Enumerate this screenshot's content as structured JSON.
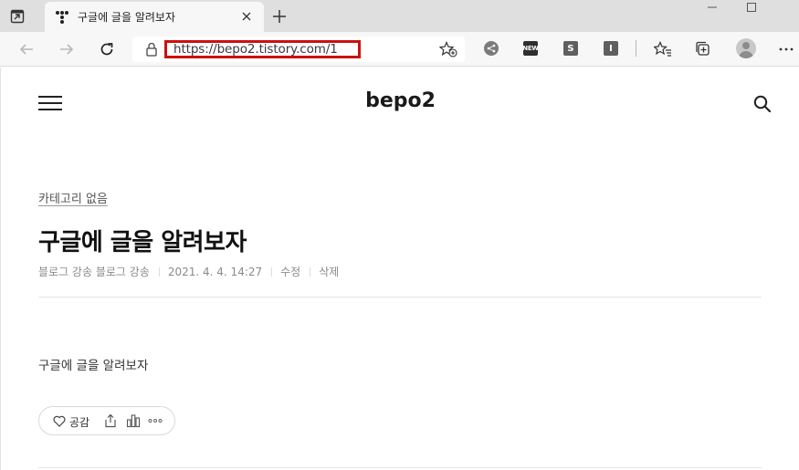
{
  "browser": {
    "tab": {
      "title": "구글에 글을 알려보자"
    },
    "address_bar": {
      "url": "https://bepo2.tistory.com/1"
    },
    "extensions": [
      {
        "icon": "share-extension-icon",
        "label": ""
      },
      {
        "icon": "new-badge-extension-icon",
        "label": "NEW"
      },
      {
        "icon": "s-extension-icon",
        "label": "S"
      },
      {
        "icon": "i-extension-icon",
        "label": "I"
      }
    ]
  },
  "site": {
    "title": "bepo2"
  },
  "post": {
    "category": "카테고리 없음",
    "title": "구글에 글을 알려보자",
    "author": "블로그 강송 블로그 강송",
    "date": "2021. 4. 4. 14:27",
    "edit_label": "수정",
    "delete_label": "삭제",
    "body": "구글에 글을 알려보자"
  },
  "actions": {
    "like_label": "공감"
  },
  "colors": {
    "highlight": "#cc1010",
    "tabstrip": "#dfdfdf",
    "toolbar": "#f7f7f7"
  }
}
